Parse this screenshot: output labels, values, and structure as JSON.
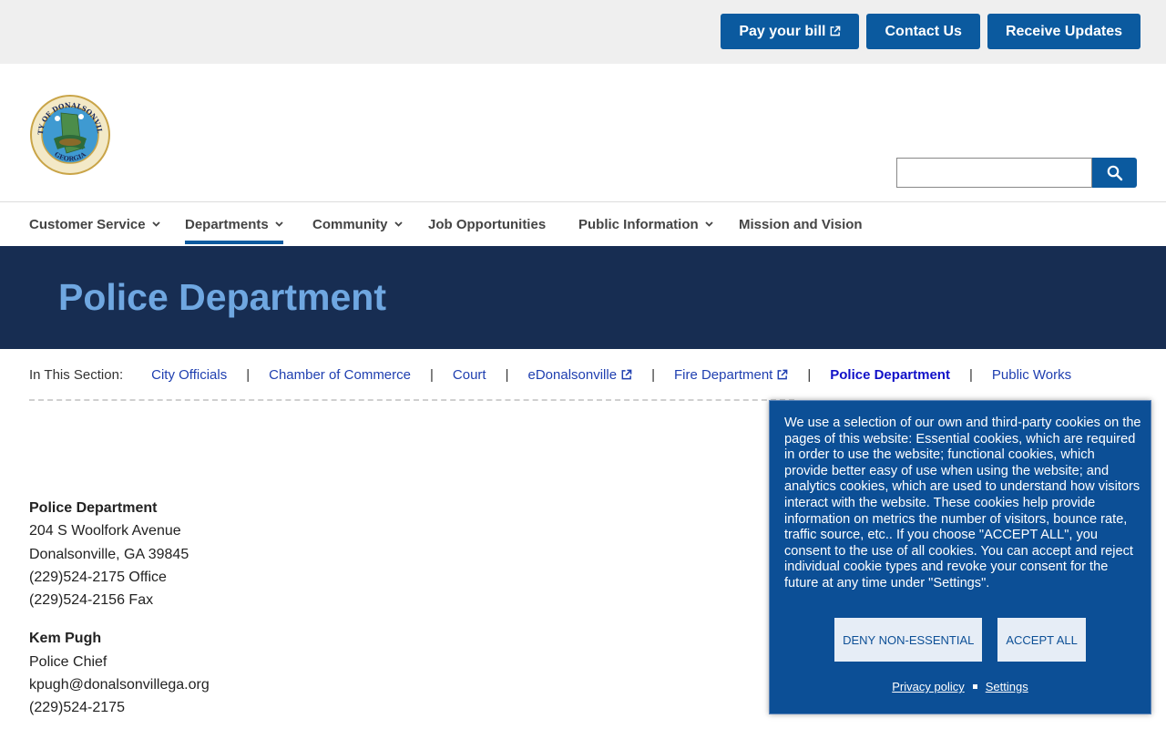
{
  "topbar": {
    "pay_label": "Pay your bill",
    "contact_label": "Contact Us",
    "updates_label": "Receive Updates"
  },
  "header": {
    "logo_text_top": "CITY OF DONALSONVILLE",
    "logo_text_bottom": "GEORGIA",
    "search": {
      "value": "",
      "placeholder": ""
    }
  },
  "nav": {
    "items": [
      {
        "label": "Customer Service",
        "dropdown": true
      },
      {
        "label": "Departments",
        "dropdown": true,
        "active": true
      },
      {
        "label": "Community",
        "dropdown": true
      },
      {
        "label": "Job Opportunities",
        "dropdown": false
      },
      {
        "label": "Public Information",
        "dropdown": true
      },
      {
        "label": "Mission and Vision",
        "dropdown": false
      }
    ]
  },
  "banner": {
    "title": "Police Department"
  },
  "section_nav": {
    "label": "In This Section:",
    "links": [
      "City Officials",
      "Chamber of Commerce",
      "Court",
      "eDonalsonville",
      "Fire Department",
      "Police Department",
      "Public Works"
    ],
    "separator": "|"
  },
  "contact": {
    "dept": {
      "name": "Police Department",
      "address1": "204 S Woolfork Avenue",
      "address2": "Donalsonville, GA 39845",
      "phone": "(229)524-2175 Office",
      "fax": "(229)524-2156 Fax"
    },
    "chief": {
      "name": "Kem Pugh",
      "title": "Police Chief",
      "email": "kpugh@donalsonvillega.org",
      "phone": "(229)524-2175"
    }
  },
  "cookie": {
    "text": "We use a selection of our own and third-party cookies on the pages of this website: Essential cookies, which are required in order to use the website; functional cookies, which provide better easy of use when using the website; and analytics cookies, which are used to understand how visitors interact with the website. These cookies help provide information on metrics the number of visitors, bounce rate, traffic source, etc.. If you choose \"ACCEPT ALL\", you consent to the use of all cookies. You can accept and reject individual cookie types and revoke your consent for the future at any time under \"Settings\".",
    "deny_label": "DENY NON-ESSENTIAL",
    "accept_label": "ACCEPT ALL",
    "privacy_label": "Privacy policy",
    "settings_label": "Settings"
  },
  "colors": {
    "primary": "#0b5a9f",
    "banner_bg": "#172d52",
    "banner_title": "#6fa7e1",
    "cookie_bg": "#0c4f96",
    "link": "#1f3fb0"
  }
}
